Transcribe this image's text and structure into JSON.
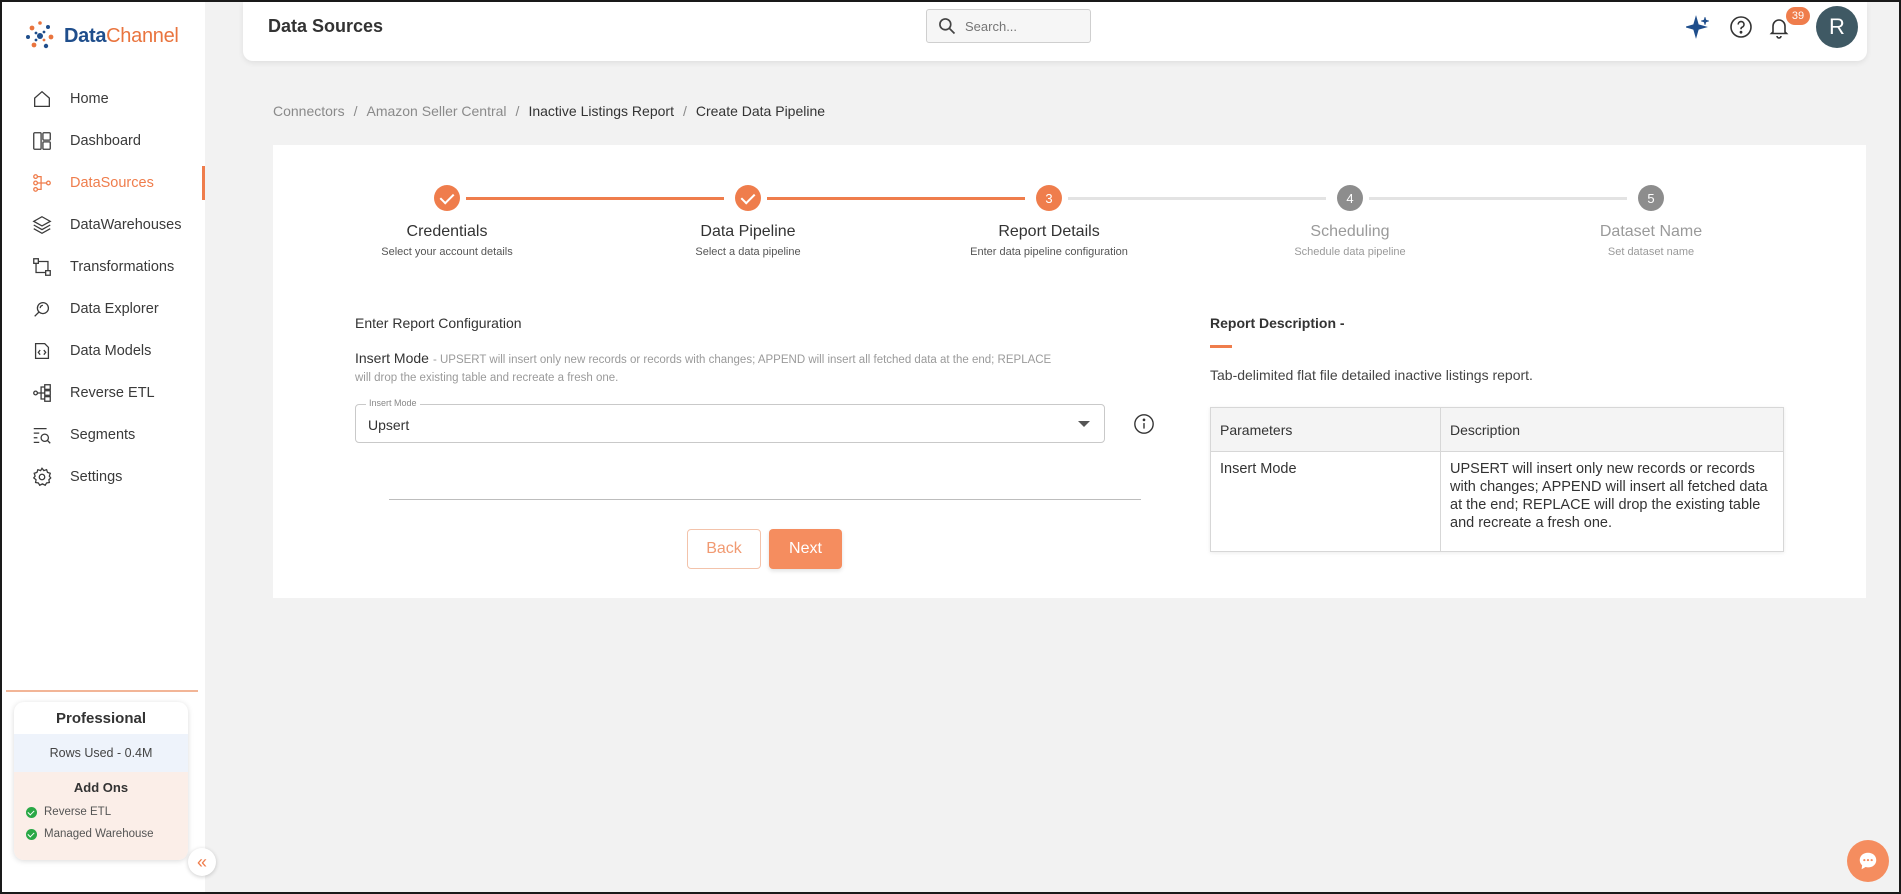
{
  "brand": {
    "name_part1": "Data",
    "name_part2": "Channel"
  },
  "sidebar": {
    "items": [
      {
        "label": "Home",
        "icon": "home-icon"
      },
      {
        "label": "Dashboard",
        "icon": "dashboard-icon"
      },
      {
        "label": "DataSources",
        "icon": "datasources-icon",
        "active": true
      },
      {
        "label": "DataWarehouses",
        "icon": "layers-icon"
      },
      {
        "label": "Transformations",
        "icon": "transform-icon"
      },
      {
        "label": "Data Explorer",
        "icon": "explorer-icon"
      },
      {
        "label": "Data Models",
        "icon": "models-icon"
      },
      {
        "label": "Reverse ETL",
        "icon": "reverse-etl-icon"
      },
      {
        "label": "Segments",
        "icon": "segments-icon"
      },
      {
        "label": "Settings",
        "icon": "gear-icon"
      }
    ],
    "plan": {
      "name": "Professional",
      "rows_used": "Rows Used - 0.4M",
      "addons_title": "Add Ons",
      "addons": [
        "Reverse ETL",
        "Managed Warehouse"
      ]
    },
    "collapse_label": "«"
  },
  "header": {
    "title": "Data Sources",
    "search_placeholder": "Search...",
    "notification_count": "39",
    "avatar_initial": "R"
  },
  "breadcrumb": [
    "Connectors",
    "Amazon Seller Central",
    "Inactive Listings Report",
    "Create Data Pipeline"
  ],
  "stepper": [
    {
      "number": "1",
      "title": "Credentials",
      "subtitle": "Select your account details",
      "state": "done"
    },
    {
      "number": "2",
      "title": "Data Pipeline",
      "subtitle": "Select a data pipeline",
      "state": "done"
    },
    {
      "number": "3",
      "title": "Report Details",
      "subtitle": "Enter data pipeline configuration",
      "state": "current"
    },
    {
      "number": "4",
      "title": "Scheduling",
      "subtitle": "Schedule data pipeline",
      "state": "todo"
    },
    {
      "number": "5",
      "title": "Dataset Name",
      "subtitle": "Set dataset name",
      "state": "todo"
    }
  ],
  "form": {
    "section_title": "Enter Report Configuration",
    "insert_mode_label": "Insert Mode",
    "insert_mode_description": "- UPSERT will insert only new records or records with changes; APPEND will insert all fetched data at the end; REPLACE will drop the existing table and recreate a fresh one.",
    "select_legend": "Insert Mode",
    "select_value": "Upsert",
    "back_label": "Back",
    "next_label": "Next"
  },
  "report_description": {
    "title": "Report Description -",
    "text": "Tab-delimited flat file detailed inactive listings report.",
    "table": {
      "headers": [
        "Parameters",
        "Description"
      ],
      "rows": [
        [
          "Insert Mode",
          "UPSERT will insert only new records or records with changes; APPEND will insert all fetched data at the end; REPLACE will drop the existing table and recreate a fresh one."
        ]
      ]
    }
  },
  "colors": {
    "accent": "#ef7d4c",
    "brand_blue": "#1f4e8c",
    "avatar_bg": "#3f5964"
  }
}
